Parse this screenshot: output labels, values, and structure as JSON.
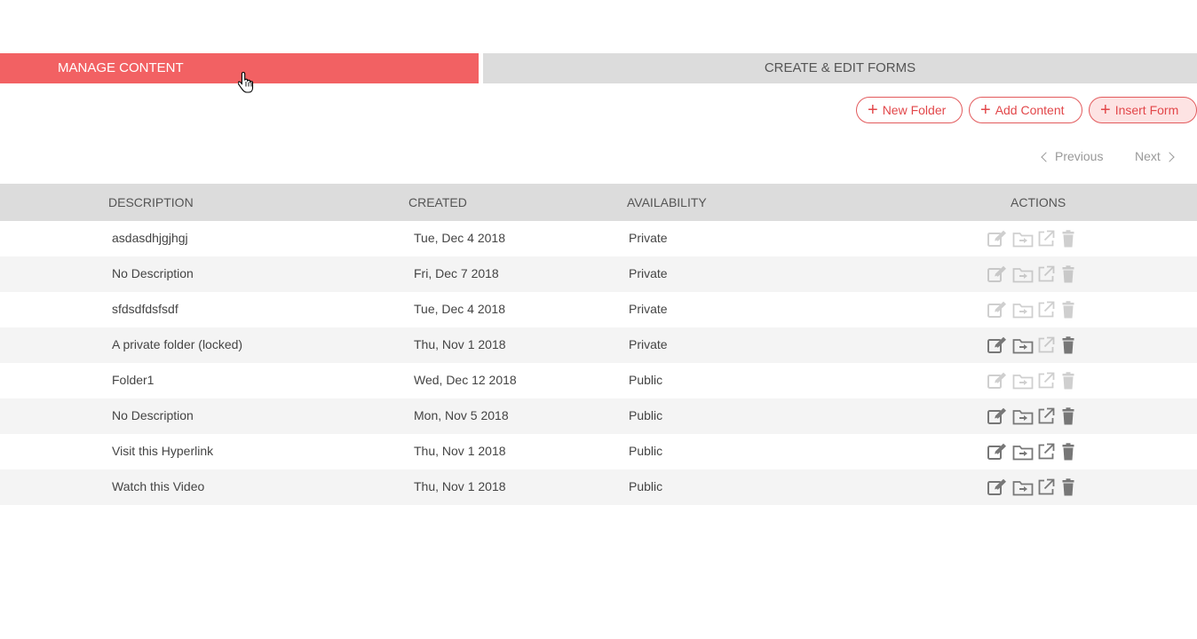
{
  "tabs": {
    "manage": "MANAGE CONTENT",
    "forms": "CREATE & EDIT FORMS"
  },
  "toolbar": {
    "new_folder": "New Folder",
    "add_content": "Add Content",
    "insert_form": "Insert Form"
  },
  "pager": {
    "previous": "Previous",
    "next": "Next"
  },
  "table": {
    "headers": {
      "description": "DESCRIPTION",
      "created": "CREATED",
      "availability": "AVAILABILITY",
      "actions": "ACTIONS"
    },
    "rows": [
      {
        "description": "asdasdhjgjhgj",
        "created": "Tue, Dec 4 2018",
        "availability": "Private",
        "actions_enabled": false
      },
      {
        "description": "No Description",
        "created": "Fri, Dec 7 2018",
        "availability": "Private",
        "actions_enabled": false
      },
      {
        "description": "sfdsdfdsfsdf",
        "created": "Tue, Dec 4 2018",
        "availability": "Private",
        "actions_enabled": false
      },
      {
        "description": "A private folder (locked)",
        "created": "Thu, Nov 1 2018",
        "availability": "Private",
        "actions_enabled": true
      },
      {
        "description": "Folder1",
        "created": "Wed, Dec 12 2018",
        "availability": "Public",
        "actions_enabled": false
      },
      {
        "description": "No Description",
        "created": "Mon, Nov 5 2018",
        "availability": "Public",
        "actions_enabled": true
      },
      {
        "description": "Visit this Hyperlink",
        "created": "Thu, Nov 1 2018",
        "availability": "Public",
        "actions_enabled": true
      },
      {
        "description": "Watch this Video",
        "created": "Thu, Nov 1 2018",
        "availability": "Public",
        "actions_enabled": true
      }
    ]
  },
  "icons": [
    "edit-icon",
    "move-folder-icon",
    "external-link-icon",
    "trash-icon",
    "plus-icon",
    "chevron-left-icon",
    "chevron-right-icon",
    "hand-cursor-icon"
  ],
  "colors": {
    "accent": "#f26163",
    "tab_inactive": "#dcdcdc",
    "header_bg": "#dcdcdc",
    "row_alt": "#f4f4f4",
    "icon": "#777777"
  }
}
